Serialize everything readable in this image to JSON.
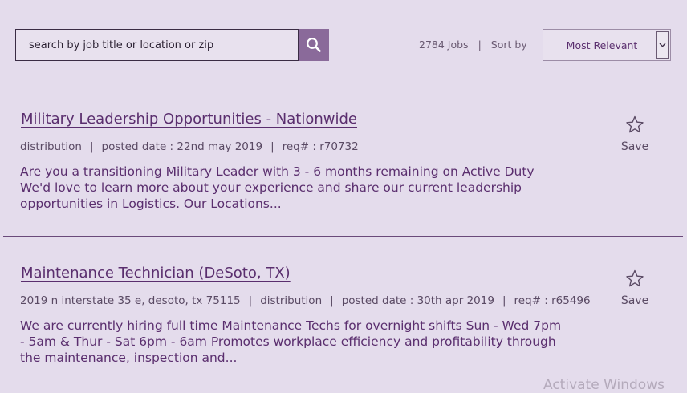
{
  "search": {
    "placeholder": "search by job title or location or zip",
    "icon": "search-icon"
  },
  "results": {
    "count_label": "2784 Jobs",
    "separator": "|",
    "sort_by_label": "Sort by",
    "sort_value": "Most Relevant"
  },
  "jobs": [
    {
      "title": "Military Leadership Opportunities - Nationwide",
      "meta": [
        "distribution",
        "posted date : 22nd may 2019",
        "req# : r70732"
      ],
      "description": "Are you a transitioning Military Leader with 3 - 6 months remaining on Active Duty We'd love to learn more about your experience and share our current leadership opportunities in Logistics. Our Locations...",
      "save_label": "Save"
    },
    {
      "title": "Maintenance Technician (DeSoto, TX)",
      "meta": [
        "2019 n interstate 35 e, desoto, tx 75115",
        "distribution",
        "posted date : 30th apr 2019",
        "req# : r65496"
      ],
      "description": "We are currently hiring full time Maintenance Techs for overnight shifts Sun - Wed 7pm - 5am & Thur - Sat 6pm - 6am Promotes workplace efficiency and profitability through the maintenance, inspection and...",
      "save_label": "Save"
    }
  ],
  "watermark": "Activate Windows",
  "colors": {
    "background": "#e4dcec",
    "accent": "#8a6a9a",
    "title": "#5a2e6e"
  }
}
